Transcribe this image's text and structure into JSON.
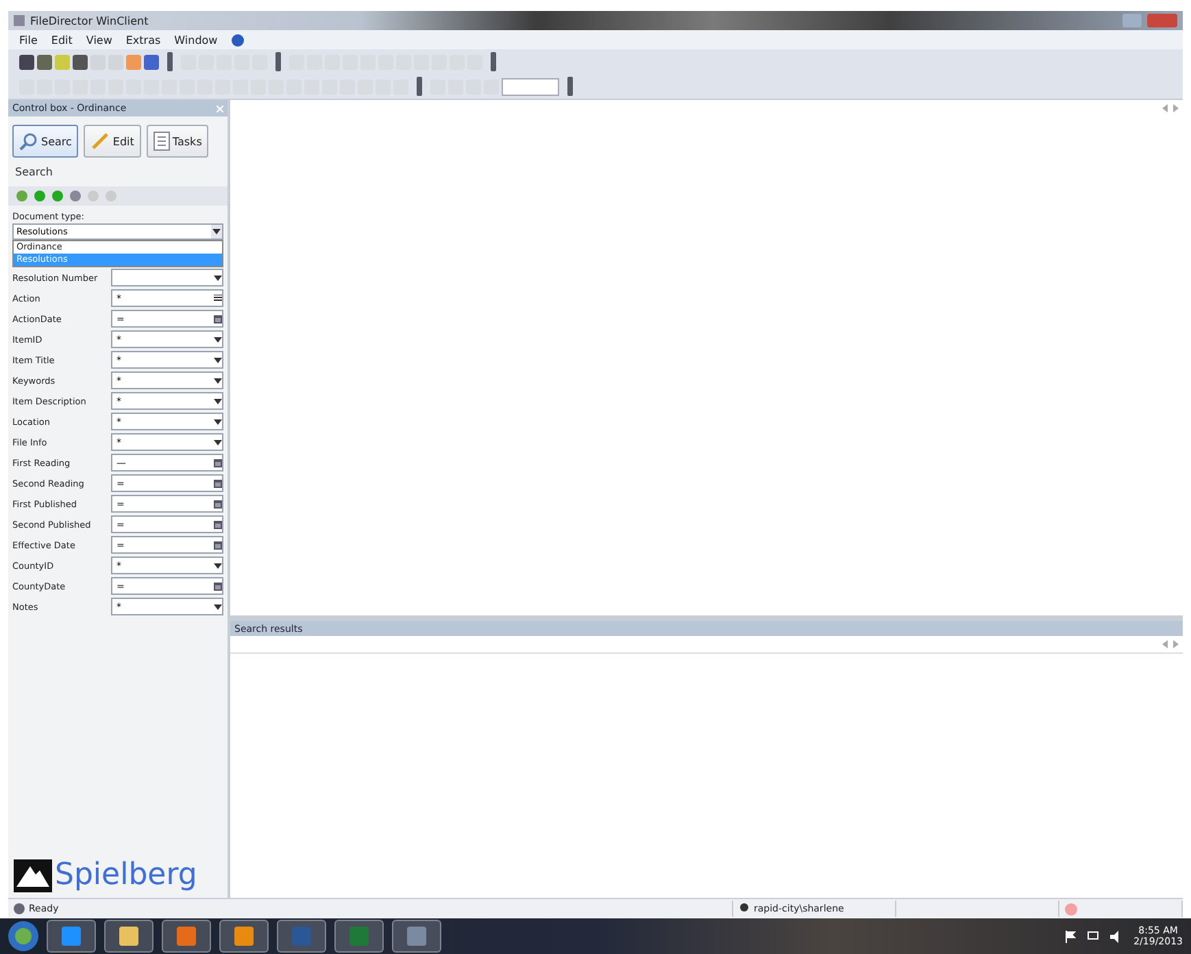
{
  "window": {
    "title": "FileDirector WinClient"
  },
  "menu": [
    {
      "label": "File"
    },
    {
      "label": "Edit"
    },
    {
      "label": "View"
    },
    {
      "label": "Extras"
    },
    {
      "label": "Window"
    }
  ],
  "control_box": {
    "title": "Control box - Ordinance",
    "buttons": [
      {
        "label": "Searc",
        "kind": "search",
        "selected": true
      },
      {
        "label": "Edit",
        "kind": "edit",
        "selected": false
      },
      {
        "label": "Tasks",
        "kind": "tasks",
        "selected": false
      }
    ],
    "section": "Search",
    "document_type": {
      "label": "Document type:",
      "value": "Resolutions",
      "options": [
        {
          "label": "Ordinance",
          "selected": false
        },
        {
          "label": "Resolutions",
          "selected": true
        }
      ]
    },
    "fields": [
      {
        "label": "Resolution Number",
        "kind": "list"
      },
      {
        "label": "Action",
        "value": "*",
        "kind": "text"
      },
      {
        "label": "ActionDate",
        "value": "=",
        "kind": "date"
      },
      {
        "label": "ItemID",
        "value": "*",
        "kind": "list"
      },
      {
        "label": "Item Title",
        "value": "*",
        "kind": "list"
      },
      {
        "label": "Keywords",
        "value": "*",
        "kind": "list"
      },
      {
        "label": "Item Description",
        "value": "*",
        "kind": "list"
      },
      {
        "label": "Location",
        "value": "*",
        "kind": "list"
      },
      {
        "label": "File Info",
        "value": "*",
        "kind": "list"
      },
      {
        "label": "First Reading",
        "value": "—",
        "kind": "date"
      },
      {
        "label": "Second Reading",
        "value": "=",
        "kind": "date"
      },
      {
        "label": "First Published",
        "value": "=",
        "kind": "date"
      },
      {
        "label": "Second Published",
        "value": "=",
        "kind": "date"
      },
      {
        "label": "Effective Date",
        "value": "=",
        "kind": "date"
      },
      {
        "label": "CountyID",
        "value": "*",
        "kind": "list"
      },
      {
        "label": "CountyDate",
        "value": "=",
        "kind": "date"
      },
      {
        "label": "Notes",
        "value": "*",
        "kind": "list"
      }
    ],
    "logo": "Spielberg"
  },
  "results": {
    "title": "Search results"
  },
  "status_bar": {
    "status": "Ready",
    "user": "rapid-city\\sharlene"
  },
  "taskbar": {
    "time": "8:55 AM",
    "date": "2/19/2013"
  }
}
